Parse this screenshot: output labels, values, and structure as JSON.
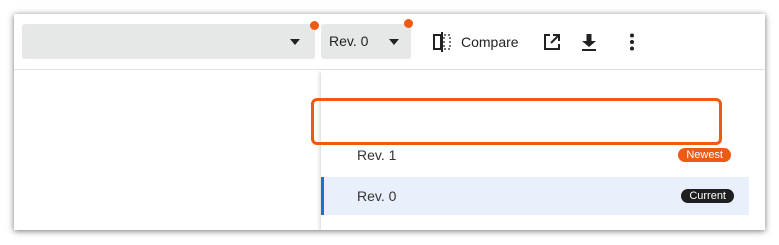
{
  "colors": {
    "accent_orange": "#ee5a14",
    "badge_dark": "#1f1f1f",
    "selected_bg": "#eaf0fb",
    "selected_bar": "#1a6fd8",
    "select_bg": "#e6e8e8"
  },
  "toolbar": {
    "primary_select": {
      "value": "",
      "icon": "chevron-down-icon"
    },
    "revision_select": {
      "value": "Rev. 0",
      "icon": "chevron-down-icon"
    },
    "compare": {
      "label": "Compare",
      "icon": "split-compare-icon"
    },
    "open_external_icon": "open-in-new-icon",
    "download_icon": "download-icon",
    "more_icon": "more-vert-icon"
  },
  "revision_menu": {
    "items": [
      {
        "label": "Rev. 1",
        "badge": "Newest",
        "badge_color": "#ee5a14",
        "selected": false
      },
      {
        "label": "Rev. 0",
        "badge": "Current",
        "badge_color": "#1f1f1f",
        "selected": true
      }
    ]
  }
}
